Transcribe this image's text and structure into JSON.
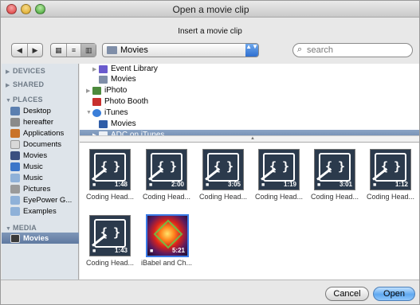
{
  "window": {
    "title": "Open a movie clip"
  },
  "dialog": {
    "message": "Insert a movie clip"
  },
  "toolbar": {
    "back_glyph": "◀",
    "forward_glyph": "▶",
    "view_icon_glyph": "▦",
    "view_list_glyph": "≡",
    "view_column_glyph": "▥",
    "location": "Movies",
    "location_arrows": "▲▼",
    "search_placeholder": "search",
    "search_glyph": "⌕"
  },
  "sidebar": {
    "devices_header": "DEVICES",
    "shared_header": "SHARED",
    "places_header": "PLACES",
    "media_header": "MEDIA",
    "places": [
      {
        "label": "Desktop",
        "icon": "desktop-icon",
        "color": "#5b7fb0"
      },
      {
        "label": "hereafter",
        "icon": "home-icon",
        "color": "#8a8a8a"
      },
      {
        "label": "Applications",
        "icon": "applications-icon",
        "color": "#c9732a"
      },
      {
        "label": "Documents",
        "icon": "documents-icon",
        "color": "#d9d9d9"
      },
      {
        "label": "Movies",
        "icon": "movies-folder-icon",
        "color": "#3a4f80"
      },
      {
        "label": "Music",
        "icon": "music-folder-icon",
        "color": "#3c76c9"
      },
      {
        "label": "Music",
        "icon": "folder-icon",
        "color": "#8fb1d8"
      },
      {
        "label": "Pictures",
        "icon": "pictures-folder-icon",
        "color": "#9a9a9a"
      },
      {
        "label": "EyePower G...",
        "icon": "folder-icon",
        "color": "#8fb1d8"
      },
      {
        "label": "Examples",
        "icon": "folder-icon",
        "color": "#8fb1d8"
      }
    ],
    "media": [
      {
        "label": "Movies",
        "icon": "film-icon",
        "color": "#3a3a3a"
      }
    ]
  },
  "tree": [
    {
      "label": "Event Library",
      "icon": "event-library-icon",
      "color": "#6a5acd"
    },
    {
      "label": "Movies",
      "icon": "folder-icon",
      "color": "#7f8ea8"
    },
    {
      "label": "iPhoto",
      "icon": "iphoto-icon",
      "color": "#4c8a3c"
    },
    {
      "label": "Photo Booth",
      "icon": "photo-booth-icon",
      "color": "#c8302e"
    },
    {
      "label": "iTunes",
      "icon": "itunes-icon",
      "color": "#3a7ed9"
    },
    {
      "label": "Movies",
      "icon": "movies-icon",
      "color": "#2f5da8"
    },
    {
      "label": "ADC on iTunes",
      "icon": "folder-icon",
      "color": "#ffffff"
    }
  ],
  "clips": [
    {
      "caption": "Coding Head...",
      "duration": "1:48"
    },
    {
      "caption": "Coding Head...",
      "duration": "2:00"
    },
    {
      "caption": "Coding Head...",
      "duration": "3:05"
    },
    {
      "caption": "Coding Head...",
      "duration": "1:19"
    },
    {
      "caption": "Coding Head...",
      "duration": "3:01"
    },
    {
      "caption": "Coding Head...",
      "duration": "1:12"
    },
    {
      "caption": "Coding Head...",
      "duration": "1:43"
    },
    {
      "caption": "iBabel and Ch...",
      "duration": "5:21"
    }
  ],
  "clip_glyph": "{ }",
  "camera_glyph": "■",
  "buttons": {
    "cancel": "Cancel",
    "open": "Open"
  },
  "colors": {
    "accent": "#3b7be6",
    "selection": "#6b87ad"
  }
}
